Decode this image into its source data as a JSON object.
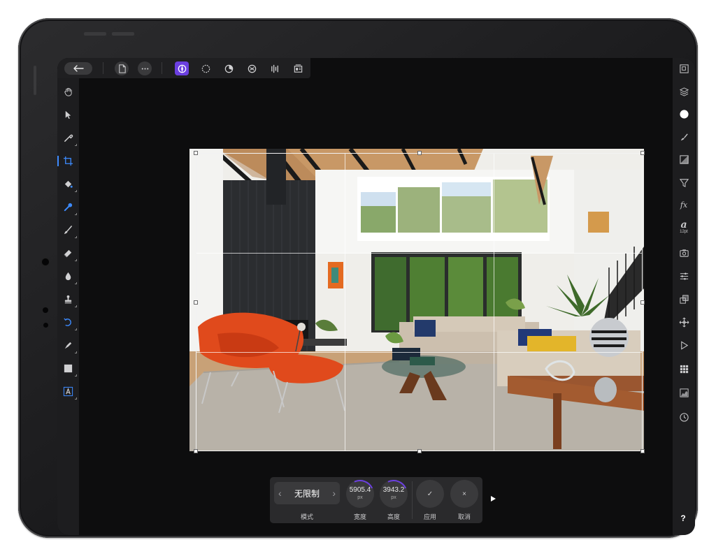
{
  "top_bar": {
    "back_icon": "arrow-left-icon",
    "document_icon": "document-icon",
    "more_icon": "more-icon",
    "personas": [
      "photo-persona-icon",
      "liquify-persona-icon",
      "develop-persona-icon",
      "tone-map-persona-icon",
      "export-persona-icon",
      "batch-persona-icon"
    ],
    "active_persona": "photo-persona-icon"
  },
  "tools": [
    "hand-icon",
    "move-icon",
    "color-picker-icon",
    "crop-icon",
    "flood-fill-icon",
    "selection-brush-icon",
    "paint-brush-icon",
    "eraser-icon",
    "blur-icon",
    "clone-stamp-icon",
    "undo-brush-icon",
    "pen-icon",
    "shape-icon",
    "text-icon"
  ],
  "active_tool": "crop-icon",
  "studio": [
    "navigator-icon",
    "layers-icon",
    "color-icon",
    "brushes-icon",
    "adjustments-icon",
    "filter-icon",
    "fx-icon",
    "character-icon",
    "snapshot-icon",
    "channels-icon",
    "transform-icon",
    "move-icon",
    "macro-icon",
    "swatches-icon",
    "histogram-icon",
    "history-icon"
  ],
  "studio_labels": {
    "fx": "fx",
    "char": "a",
    "char_size": "12pt"
  },
  "crop": {
    "mode_label": "模式",
    "mode_value": "无限制",
    "width_value": "5905.4",
    "width_unit": "px",
    "width_label": "宽度",
    "height_value": "3943.2",
    "height_unit": "px",
    "height_label": "高度",
    "apply_label": "应用",
    "apply_symbol": "✓",
    "cancel_label": "取消",
    "cancel_symbol": "×"
  },
  "help_label": "?",
  "colors": {
    "accent": "#6b3fe0",
    "panel": "#1d1d1f",
    "canvas": "#0d0d0e"
  }
}
